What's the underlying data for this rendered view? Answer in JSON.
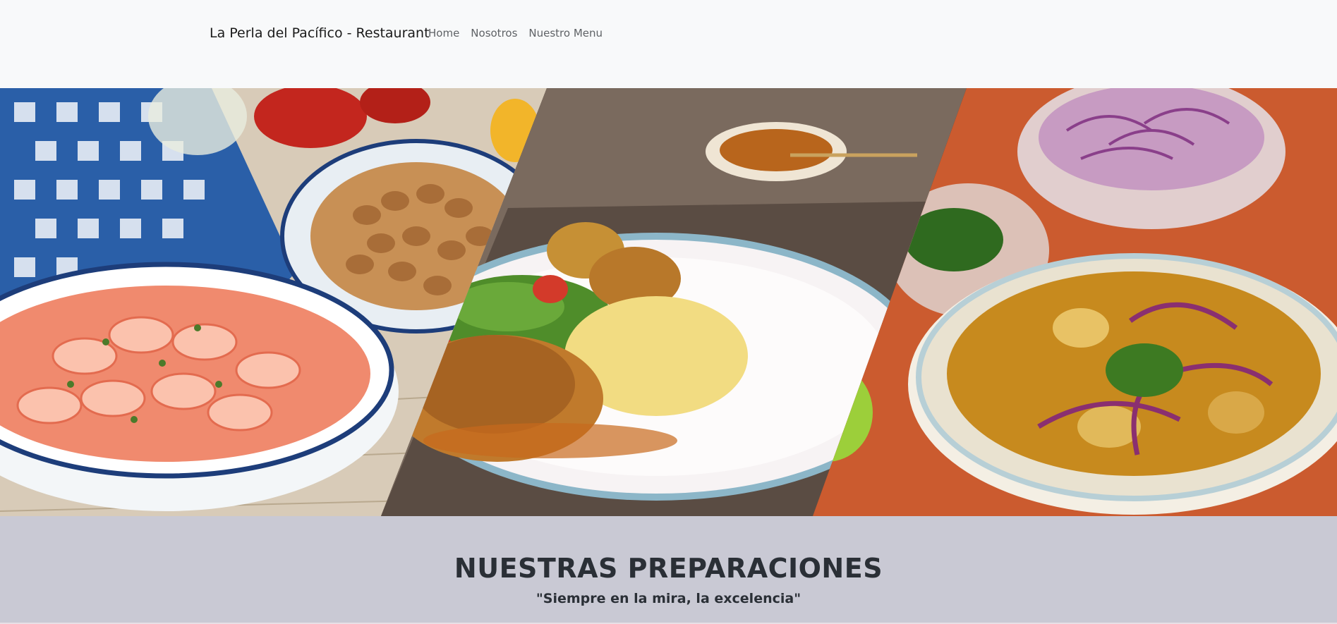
{
  "navbar": {
    "brand": "La Perla del Pacífico - Restaurant",
    "links": [
      {
        "label": "Home"
      },
      {
        "label": "Nosotros"
      },
      {
        "label": "Nuestro Menu"
      }
    ]
  },
  "hero": {
    "images": [
      {
        "name": "ceviche-de-camaron-image"
      },
      {
        "name": "seco-con-arroz-image"
      },
      {
        "name": "encebollado-image"
      }
    ]
  },
  "section": {
    "title": "NUESTRAS PREPARACIONES",
    "subtitle": "\"Siempre en la mira, la excelencia\""
  },
  "colors": {
    "navbar_bg": "#f8f9fa",
    "section_bg": "#c9c9d4",
    "heading": "#2a2f36"
  }
}
